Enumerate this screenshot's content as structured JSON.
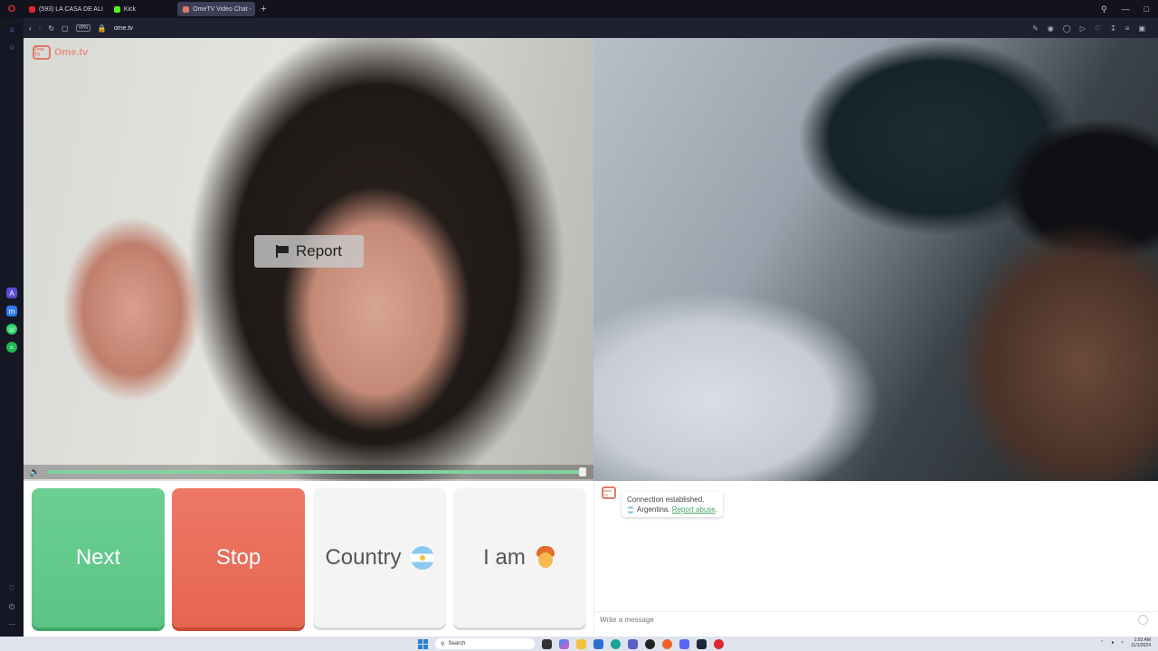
{
  "browser": {
    "tabs": [
      {
        "label": "(593) LA CASA DE ALI",
        "color": "#e0262f",
        "active": false
      },
      {
        "label": "Kick",
        "color": "#53fc18",
        "active": false
      },
      {
        "label": "OmeTV Video Chat -",
        "color": "#e07b67",
        "active": true
      }
    ],
    "new_tab": "+",
    "url": "ome.tv",
    "vpn_label": "VPN"
  },
  "site": {
    "logo_tv": "Ome TV",
    "logo_text": "Ome.tv",
    "report_label": "Report",
    "volume_level": 1.0
  },
  "controls": {
    "next_label": "Next",
    "stop_label": "Stop",
    "country_label": "Country",
    "iam_label": "I am"
  },
  "chat": {
    "logo_tv": "Ome TV",
    "connection_text": "Connection established.",
    "country_text": "Argentina.",
    "report_link": "Report abuse",
    "link_trail": ".",
    "input_placeholder": "Write a message"
  },
  "taskbar": {
    "search_placeholder": "Search",
    "time": "1:03 AM",
    "date": "11/1/2024"
  },
  "colors": {
    "next": "#5bc485",
    "stop": "#e6654f",
    "accent": "#e07b67",
    "volume_fill": "#7fd3a2"
  }
}
